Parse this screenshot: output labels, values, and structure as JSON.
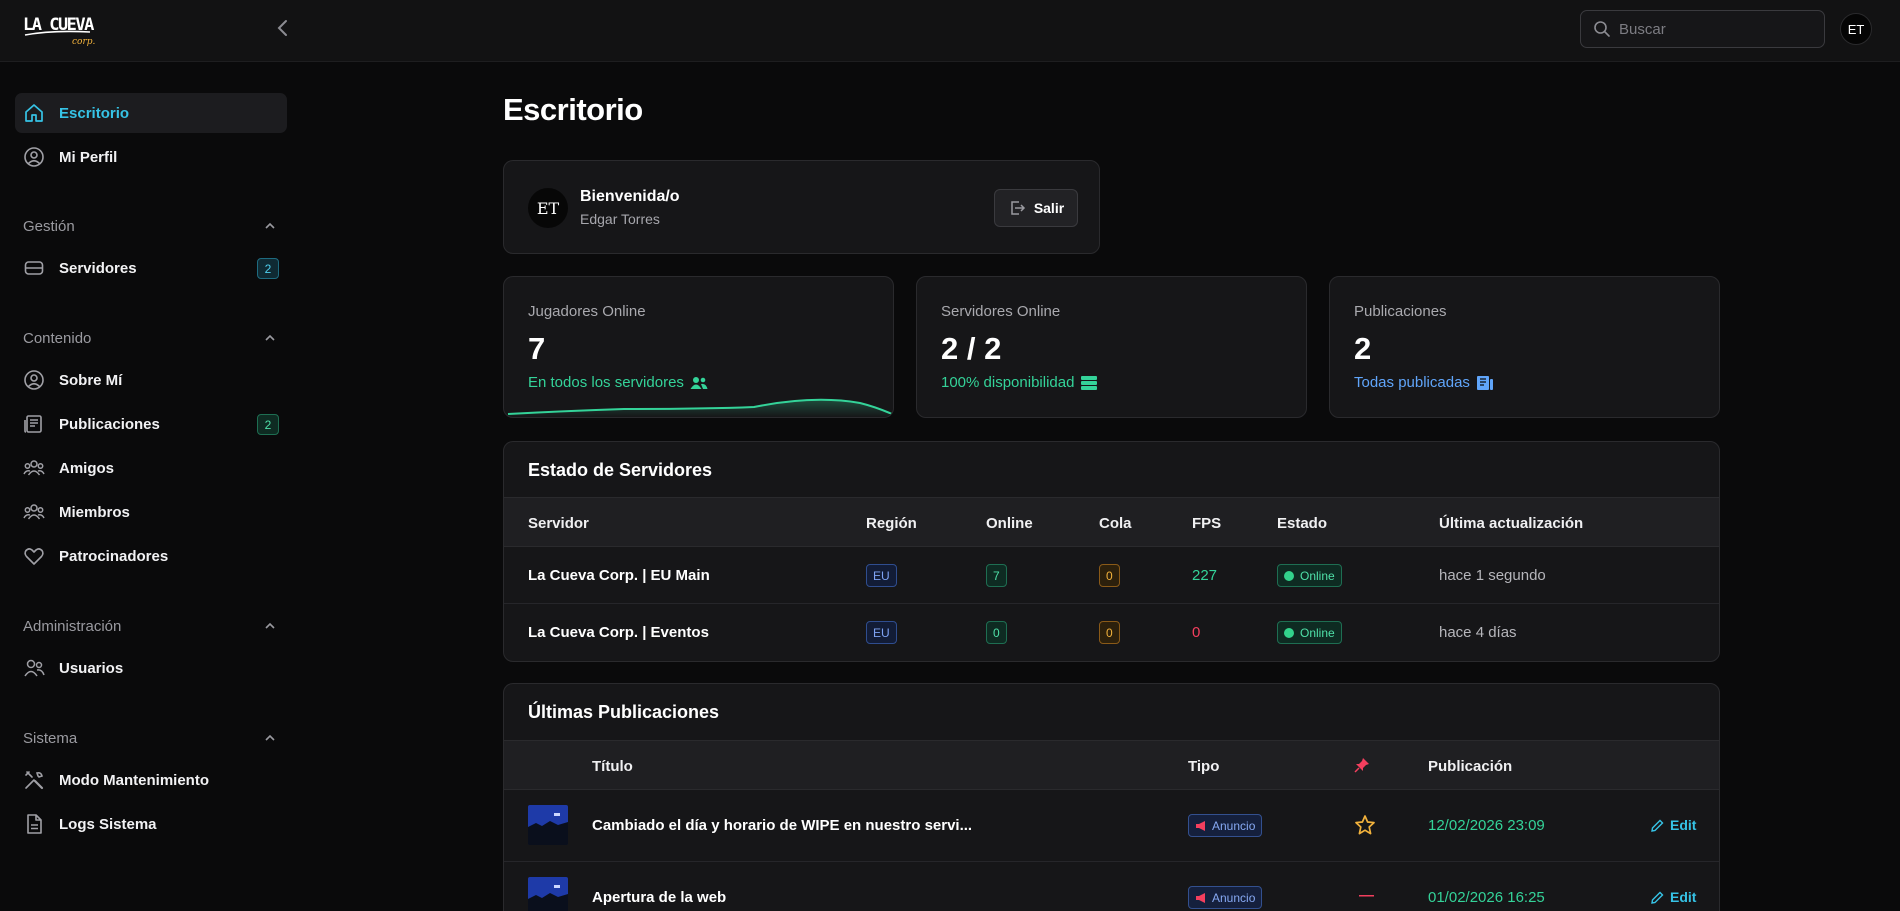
{
  "header": {
    "logo_text": "LA CUEVA",
    "logo_sub": "corp.",
    "search_placeholder": "Buscar",
    "user_initials": "ET"
  },
  "sidebar": {
    "items": [
      {
        "label": "Escritorio",
        "icon": "home-icon",
        "active": true
      },
      {
        "label": "Mi Perfil",
        "icon": "user-circle-icon"
      }
    ],
    "sections": [
      {
        "title": "Gestión",
        "items": [
          {
            "label": "Servidores",
            "icon": "server-icon",
            "badge": "2"
          }
        ]
      },
      {
        "title": "Contenido",
        "items": [
          {
            "label": "Sobre Mí",
            "icon": "user-circle-icon"
          },
          {
            "label": "Publicaciones",
            "icon": "newspaper-icon",
            "badge": "2"
          },
          {
            "label": "Amigos",
            "icon": "users-icon"
          },
          {
            "label": "Miembros",
            "icon": "users-icon"
          },
          {
            "label": "Patrocinadores",
            "icon": "heart-icon"
          }
        ]
      },
      {
        "title": "Administración",
        "items": [
          {
            "label": "Usuarios",
            "icon": "users-icon"
          }
        ]
      },
      {
        "title": "Sistema",
        "items": [
          {
            "label": "Modo Mantenimiento",
            "icon": "tools-icon"
          },
          {
            "label": "Logs Sistema",
            "icon": "file-icon"
          }
        ]
      }
    ]
  },
  "main": {
    "title": "Escritorio",
    "welcome": {
      "initials": "ET",
      "greeting": "Bienvenida/o",
      "name": "Edgar Torres",
      "logout_label": "Salir"
    },
    "stats": [
      {
        "label": "Jugadores Online",
        "value": "7",
        "sub": "En todos los servidores",
        "sub_color": "#34d399"
      },
      {
        "label": "Servidores Online",
        "value": "2 / 2",
        "sub": "100% disponibilidad",
        "sub_color": "#34d399"
      },
      {
        "label": "Publicaciones",
        "value": "2",
        "sub": "Todas publicadas",
        "sub_color": "#60a5fa"
      }
    ],
    "servers": {
      "title": "Estado de Servidores",
      "columns": [
        "Servidor",
        "Región",
        "Online",
        "Cola",
        "FPS",
        "Estado",
        "Última actualización"
      ],
      "rows": [
        {
          "name": "La Cueva Corp. | EU Main",
          "region": "EU",
          "online": "7",
          "queue": "0",
          "fps": "227",
          "status": "Online",
          "updated": "hace 1 segundo"
        },
        {
          "name": "La Cueva Corp. | Eventos",
          "region": "EU",
          "online": "0",
          "queue": "0",
          "fps": "0",
          "status": "Online",
          "updated": "hace 4 días"
        }
      ]
    },
    "posts": {
      "title": "Últimas Publicaciones",
      "columns": [
        "Título",
        "Tipo",
        "pin-icon",
        "Publicación"
      ],
      "rows": [
        {
          "title": "Cambiado el día y horario de WIPE en nuestro servi...",
          "type": "Anuncio",
          "pinned": true,
          "date": "12/02/2026 23:09",
          "action": "Edit"
        },
        {
          "title": "Apertura de la web",
          "type": "Anuncio",
          "pinned": false,
          "pin_text": "—",
          "date": "01/02/2026 16:25",
          "action": "Edit"
        }
      ]
    }
  },
  "colors": {
    "accent": "#36c3e6",
    "green": "#34d399",
    "blue": "#60a5fa",
    "red": "#f43f5e",
    "orange": "#f2b23c"
  }
}
